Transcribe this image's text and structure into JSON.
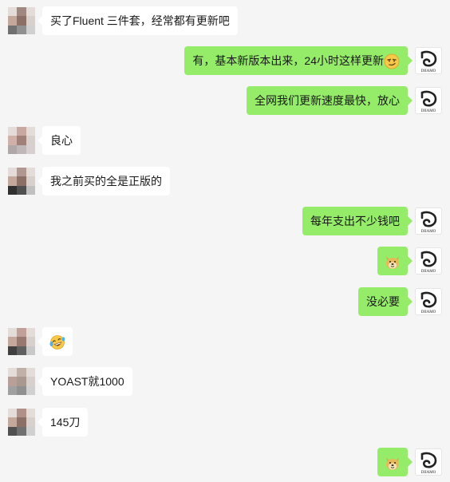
{
  "colors": {
    "background": "#f5f5f5",
    "bubble_incoming": "#ffffff",
    "bubble_outgoing": "#95ec69",
    "text": "#191919"
  },
  "contact_avatar": {
    "icon": "pixelated-user-avatar-icon",
    "tiles": [
      "#b8a8a0",
      "#a08880",
      "#ccc4c0",
      "#c4a89c",
      "#8c7068",
      "#d8d0cc",
      "#707070",
      "#a0a0a0",
      "#d0d0d0"
    ]
  },
  "my_avatar": {
    "icon": "brand-logo-icon",
    "logo_text": "DIIAMO"
  },
  "messages": [
    {
      "side": "left",
      "text": "买了Fluent 三件套，经常都有更新吧"
    },
    {
      "side": "right",
      "text": "有，基本新版本出来，24小时这样更新",
      "emoji_after": "smirk-face-emoji"
    },
    {
      "side": "right",
      "text": "全网我们更新速度最快，放心"
    },
    {
      "side": "left",
      "text": "良心"
    },
    {
      "side": "left",
      "text": "我之前买的全是正版的"
    },
    {
      "side": "right",
      "text": "每年支出不少钱吧"
    },
    {
      "side": "right",
      "emoji": "doge-emoji"
    },
    {
      "side": "right",
      "text": "没必要"
    },
    {
      "side": "left",
      "emoji": "laughing-tears-emoji"
    },
    {
      "side": "left",
      "text": "YOAST就1000"
    },
    {
      "side": "left",
      "text": "145刀"
    },
    {
      "side": "right",
      "emoji": "doge-emoji"
    }
  ]
}
